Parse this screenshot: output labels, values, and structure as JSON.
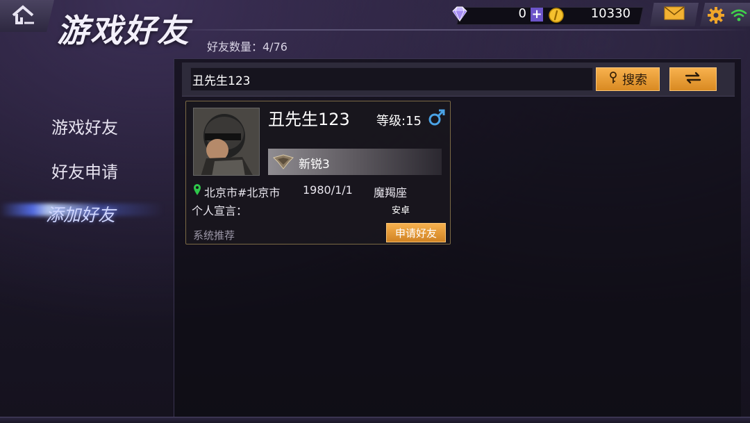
{
  "header": {
    "title": "游戏好友",
    "friend_count_label": "好友数量：4/76"
  },
  "currency": {
    "gems": "0",
    "plus": "+",
    "coins": "10330"
  },
  "icons": {
    "home": "home-icon",
    "gem": "diamond-icon",
    "coin": "gold-coin-icon",
    "mail": "mail-icon",
    "settings": "gear-icon",
    "wifi": "wifi-icon",
    "search": "key-search-icon",
    "refresh": "swap-arrows-icon",
    "gender": "male-icon",
    "location": "location-pin-icon",
    "rank": "rank-badge-icon"
  },
  "sidebar": {
    "items": [
      {
        "label": "游戏好友",
        "active": false
      },
      {
        "label": "好友申请",
        "active": false
      },
      {
        "label": "添加好友",
        "active": true
      }
    ]
  },
  "search": {
    "value": "丑先生123",
    "button_label": "搜索"
  },
  "result_card": {
    "name": "丑先生123",
    "level": "等级:15",
    "rank": "新锐3",
    "location": "北京市#北京市",
    "birthday": "1980/1/1",
    "zodiac": "魔羯座",
    "signature_label": "个人宣言：",
    "platform": "安卓",
    "source": "系统推荐",
    "apply_label": "申请好友"
  },
  "colors": {
    "accent_orange": "#e9a03c",
    "gender_blue": "#4aa3e6",
    "location_green": "#2ec74a",
    "active_nav": "#5a78ff"
  }
}
